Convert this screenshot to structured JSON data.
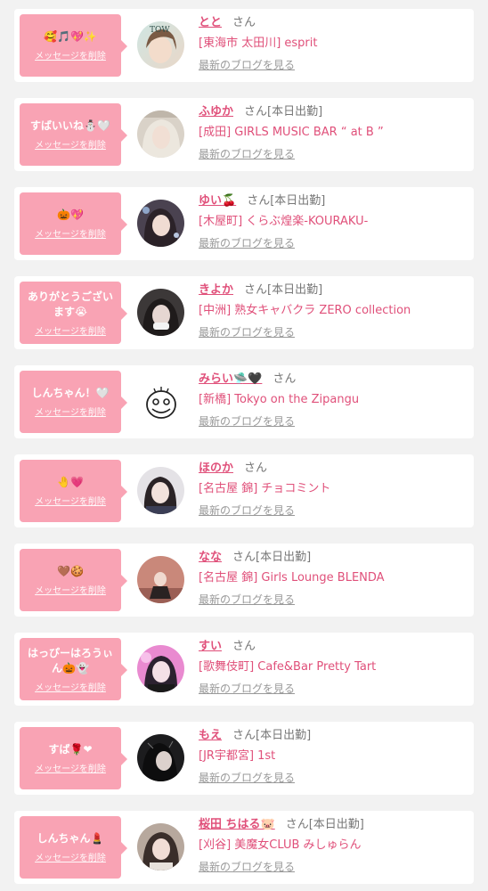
{
  "colors": {
    "bubble": "#f9a3b4",
    "name": "#e0507a",
    "shop": "#e0507a",
    "muted": "#777777",
    "link": "#999999"
  },
  "items": [
    {
      "msg": "🥰🎵💖✨",
      "name": "とと",
      "today": "",
      "shop": "[東海市 太田川] esprit"
    },
    {
      "msg": "すばいいね⛄🤍",
      "name": "ふゆか",
      "today": "[本日出勤]",
      "shop": "[成田] GIRLS MUSIC BAR “ at B ”"
    },
    {
      "msg": "🎃💖",
      "name": "ゆい🍒",
      "today": "[本日出勤]",
      "shop": "[木屋町] くらぶ煌楽-KOURAKU-"
    },
    {
      "msg": "ありがとうございます😭",
      "name": "きよか",
      "today": "[本日出勤]",
      "shop": "[中洲] 熟女キャバクラ ZERO collection"
    },
    {
      "msg": "しんちゃん！🤍",
      "name": "みらい🛸🖤",
      "today": "",
      "shop": "[新橋] Tokyo on the Zipangu"
    },
    {
      "msg": "🤚💗",
      "name": "ほのか",
      "today": "",
      "shop": "[名古屋 錦] チョコミント"
    },
    {
      "msg": "🤎🍪",
      "name": "なな",
      "today": "[本日出勤]",
      "shop": "[名古屋 錦] Girls Lounge BLENDA"
    },
    {
      "msg": "はっぴーはろうぃん🎃👻",
      "name": "すい",
      "today": "",
      "shop": "[歌舞伎町] Cafe&Bar Pretty Tart"
    },
    {
      "msg": "すば🌹❤",
      "name": "もえ",
      "today": "[本日出勤]",
      "shop": "[JR宇都宮] 1st"
    },
    {
      "msg": "しんちゃん💄",
      "name": "桜田 ちはる🐷",
      "today": "[本日出勤]",
      "shop": "[刈谷] 美魔女CLUB みしゅらん"
    }
  ],
  "labels": {
    "delete": "メッセージを削除",
    "san": "さん",
    "blog": "最新のブログを見る"
  }
}
